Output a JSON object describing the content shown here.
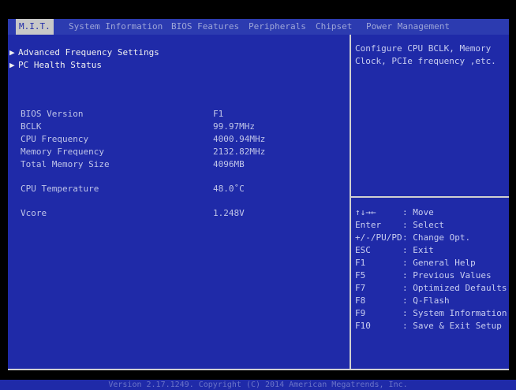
{
  "tabs": [
    {
      "label": "M.I.T.",
      "active": true
    },
    {
      "label": "System Information",
      "active": false
    },
    {
      "label": "BIOS Features",
      "active": false
    },
    {
      "label": "Peripherals",
      "active": false
    },
    {
      "label": "Chipset",
      "active": false
    },
    {
      "label": "Power Management",
      "active": false
    }
  ],
  "menu": [
    {
      "label": "Advanced Frequency Settings"
    },
    {
      "label": "PC Health Status"
    }
  ],
  "info": [
    {
      "label": "BIOS Version",
      "value": "F1"
    },
    {
      "label": "BCLK",
      "value": "99.97MHz"
    },
    {
      "label": "CPU Frequency",
      "value": "4000.94MHz"
    },
    {
      "label": "Memory Frequency",
      "value": "2132.82MHz"
    },
    {
      "label": "Total Memory Size",
      "value": "4096MB"
    },
    {
      "label": "CPU Temperature",
      "value": "48.0˚C"
    },
    {
      "label": "Vcore",
      "value": "1.248V"
    }
  ],
  "help_text": "Configure CPU BCLK, Memory\nClock, PCIe frequency ,etc.",
  "keys": [
    {
      "key": "↑↓→←",
      "desc": ": Move"
    },
    {
      "key": "Enter",
      "desc": ": Select"
    },
    {
      "key": "+/-/PU/PD",
      "desc": ": Change Opt."
    },
    {
      "key": "ESC",
      "desc": ": Exit"
    },
    {
      "key": "F1",
      "desc": ": General Help"
    },
    {
      "key": "F5",
      "desc": ": Previous Values"
    },
    {
      "key": "F7",
      "desc": ": Optimized Defaults"
    },
    {
      "key": "F8",
      "desc": ": Q-Flash"
    },
    {
      "key": "F9",
      "desc": ": System Information"
    },
    {
      "key": "F10",
      "desc": ": Save & Exit Setup"
    }
  ],
  "footer": "Version 2.17.1249. Copyright (C) 2014 American Megatrends, Inc."
}
